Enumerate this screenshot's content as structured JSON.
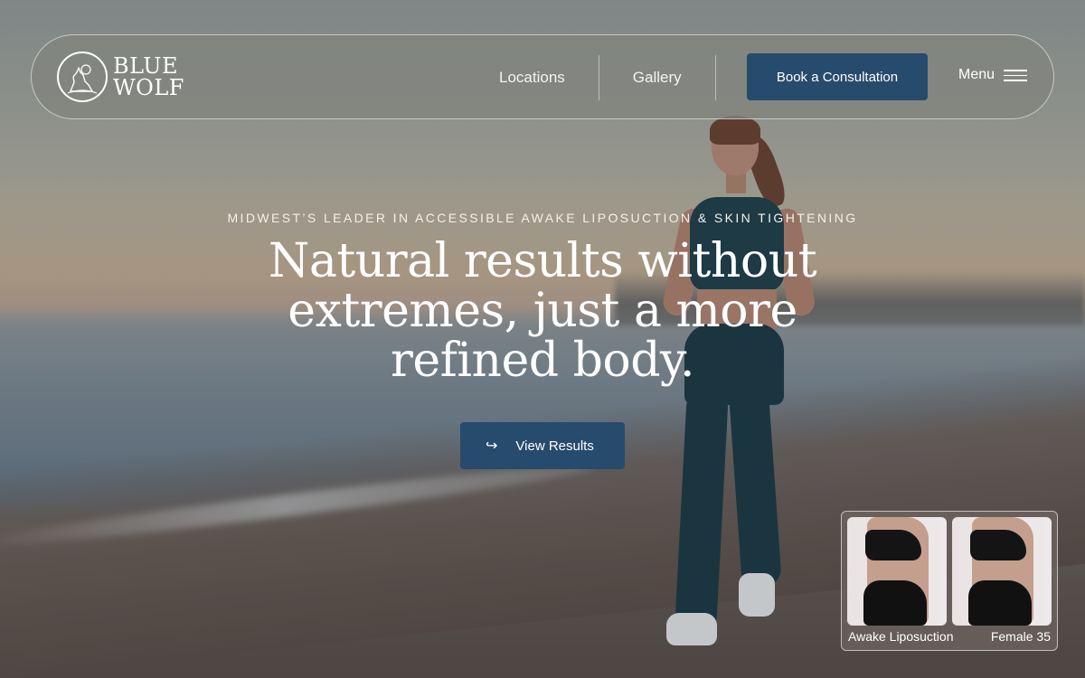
{
  "brand": {
    "logo_line1": "BLUE",
    "logo_line2": "WOLF",
    "logo_icon": "wolf-howling-icon"
  },
  "nav": {
    "items": [
      {
        "label": "Locations"
      },
      {
        "label": "Gallery"
      }
    ],
    "cta_label": "Book a Consultation",
    "menu_label": "Menu",
    "menu_icon": "hamburger-icon"
  },
  "hero": {
    "eyebrow": "MIDWEST’S LEADER IN ACCESSIBLE AWAKE LIPOSUCTION & SKIN TIGHTENING",
    "heading": "Natural results without extremes, just a more refined body.",
    "cta_label": "View Results",
    "cta_icon": "arrow-right-hook-icon"
  },
  "result_card": {
    "procedure": "Awake Liposuction",
    "patient": "Female 35"
  },
  "colors": {
    "accent": "#264b6d",
    "text": "#ffffff"
  }
}
